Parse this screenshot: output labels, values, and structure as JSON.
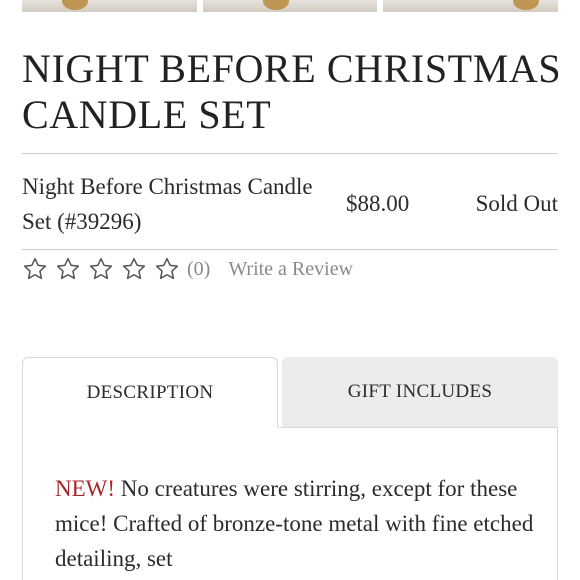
{
  "product": {
    "title": "NIGHT BEFORE CHRISTMAS CANDLE SET",
    "variant_name": "Night Before Christmas Candle Set (#39296)",
    "price": "$88.00",
    "availability": "Sold Out"
  },
  "rating": {
    "stars_filled": 0,
    "stars_total": 5,
    "count_text": "(0)",
    "write_review_label": "Write a Review"
  },
  "tabs": [
    {
      "label": "DESCRIPTION",
      "active": true
    },
    {
      "label": "GIFT INCLUDES",
      "active": false
    }
  ],
  "description": {
    "badge": "NEW!",
    "text": " No creatures were stirring, except for these mice! Crafted of bronze-tone metal with fine etched detailing, set"
  },
  "colors": {
    "accent_new": "#a8262b",
    "text": "#2b2b2b",
    "muted": "#8a8a8a",
    "inactive_tab": "#ececec"
  },
  "icons": {
    "star": "star-outline-icon"
  }
}
